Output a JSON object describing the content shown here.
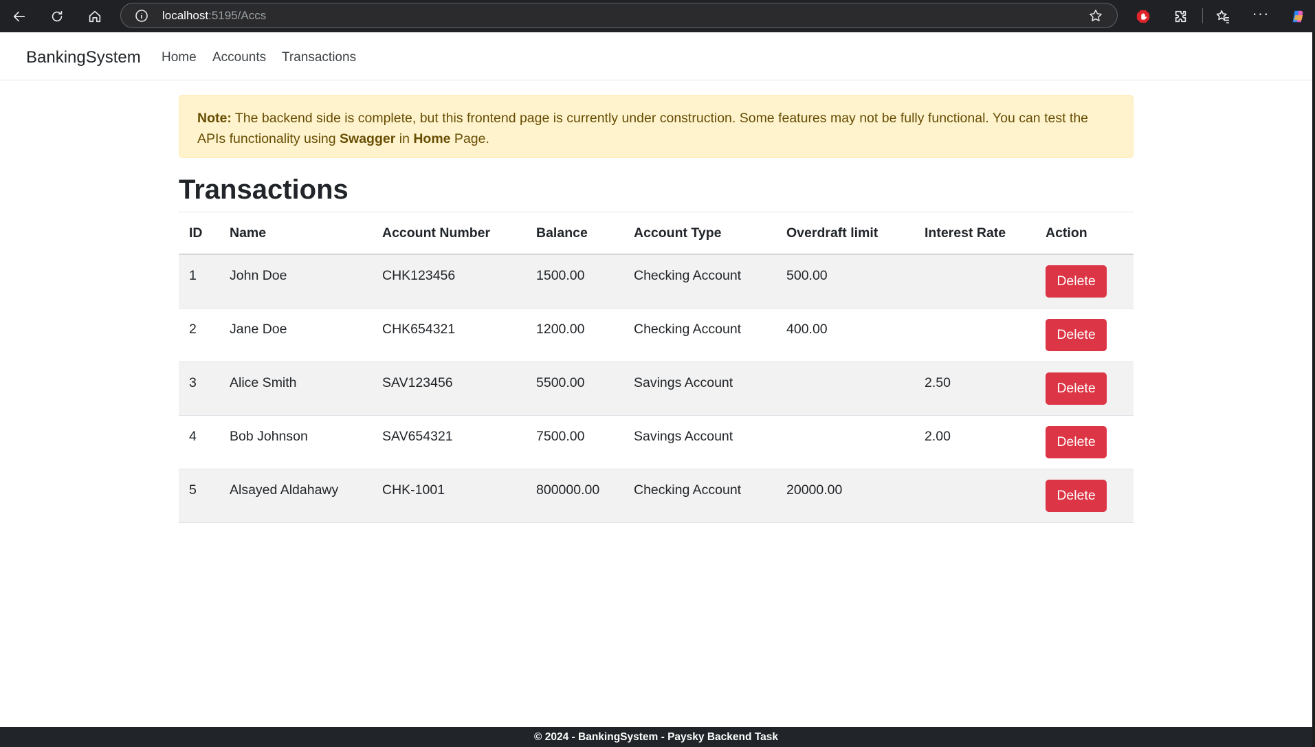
{
  "browser": {
    "url_host": "localhost",
    "url_path": ":5195/Accs"
  },
  "navbar": {
    "brand": "BankingSystem",
    "links": [
      "Home",
      "Accounts",
      "Transactions"
    ]
  },
  "alert": {
    "note_label": "Note:",
    "text_before_swagger": " The backend side is complete, but this frontend page is currently under construction. Some features may not be fully functional. You can test the APIs functionality using ",
    "swagger": "Swagger",
    "text_in": " in ",
    "home": "Home",
    "text_end": " Page."
  },
  "page": {
    "title": "Transactions"
  },
  "table": {
    "headers": [
      "ID",
      "Name",
      "Account Number",
      "Balance",
      "Account Type",
      "Overdraft limit",
      "Interest Rate",
      "Action"
    ],
    "rows": [
      {
        "id": "1",
        "name": "John Doe",
        "account_number": "CHK123456",
        "balance": "1500.00",
        "account_type": "Checking Account",
        "overdraft_limit": "500.00",
        "interest_rate": "",
        "action": "Delete"
      },
      {
        "id": "2",
        "name": "Jane Doe",
        "account_number": "CHK654321",
        "balance": "1200.00",
        "account_type": "Checking Account",
        "overdraft_limit": "400.00",
        "interest_rate": "",
        "action": "Delete"
      },
      {
        "id": "3",
        "name": "Alice Smith",
        "account_number": "SAV123456",
        "balance": "5500.00",
        "account_type": "Savings Account",
        "overdraft_limit": "",
        "interest_rate": "2.50",
        "action": "Delete"
      },
      {
        "id": "4",
        "name": "Bob Johnson",
        "account_number": "SAV654321",
        "balance": "7500.00",
        "account_type": "Savings Account",
        "overdraft_limit": "",
        "interest_rate": "2.00",
        "action": "Delete"
      },
      {
        "id": "5",
        "name": "Alsayed Aldahawy",
        "account_number": "CHK-1001",
        "balance": "800000.00",
        "account_type": "Checking Account",
        "overdraft_limit": "20000.00",
        "interest_rate": "",
        "action": "Delete"
      }
    ]
  },
  "footer": {
    "text": "© 2024 - BankingSystem - Paysky Backend Task"
  },
  "colors": {
    "danger": "#dc3545",
    "alert_bg": "#fff3cd",
    "alert_text": "#664d03",
    "footer_bg": "#212529"
  },
  "icons": [
    "back-arrow-icon",
    "reload-icon",
    "home-icon",
    "site-info-icon",
    "favorite-star-icon",
    "adblock-icon",
    "extensions-puzzle-icon",
    "favorites-icon",
    "more-icon",
    "copilot-icon"
  ]
}
